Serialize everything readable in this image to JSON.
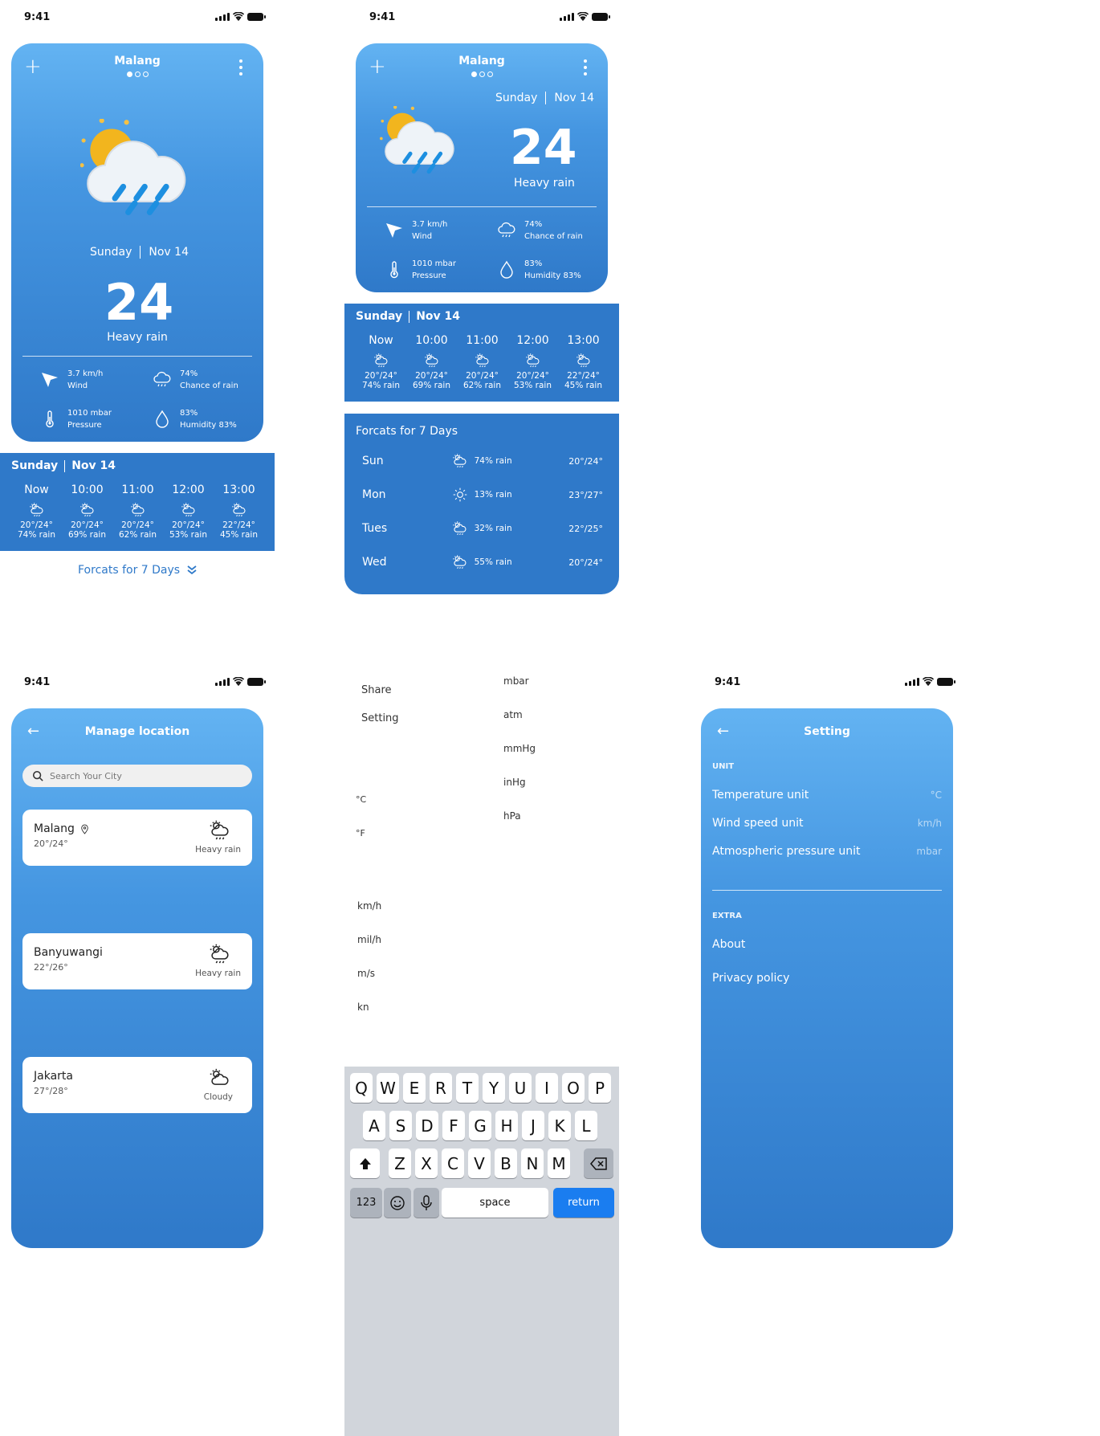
{
  "status": {
    "time": "9:41"
  },
  "screen1": {
    "city": "Malang",
    "day": "Sunday",
    "date": "Nov 14",
    "temp": "24",
    "deg_symbol": "°",
    "condition": "Heavy rain",
    "stats": {
      "wind_value": "3.7 km/h",
      "wind_label": "Wind",
      "rain_value": "74%",
      "rain_label": "Chance of rain",
      "pressure_value": "1010 mbar",
      "pressure_label": "Pressure",
      "humidity_value": "83%",
      "humidity_label": "Humidity 83%"
    },
    "hourly": {
      "day": "Sunday",
      "date": "Nov 14",
      "items": [
        {
          "time": "Now",
          "temps": "20°/24°",
          "rain": "74% rain"
        },
        {
          "time": "10:00",
          "temps": "20°/24°",
          "rain": "69% rain"
        },
        {
          "time": "11:00",
          "temps": "20°/24°",
          "rain": "62% rain"
        },
        {
          "time": "12:00",
          "temps": "20°/24°",
          "rain": "53% rain"
        },
        {
          "time": "13:00",
          "temps": "22°/24°",
          "rain": "45% rain"
        }
      ]
    },
    "forecast_link": "Forcats for 7 Days"
  },
  "screen2": {
    "city": "Malang",
    "day": "Sunday",
    "date": "Nov 14",
    "temp": "24",
    "deg_symbol": "°",
    "condition": "Heavy rain",
    "stats": {
      "wind_value": "3.7 km/h",
      "wind_label": "Wind",
      "rain_value": "74%",
      "rain_label": "Chance of rain",
      "pressure_value": "1010 mbar",
      "pressure_label": "Pressure",
      "humidity_value": "83%",
      "humidity_label": "Humidity 83%"
    },
    "hourly": {
      "day": "Sunday",
      "date": "Nov 14",
      "items": [
        {
          "time": "Now",
          "temps": "20°/24°",
          "rain": "74% rain"
        },
        {
          "time": "10:00",
          "temps": "20°/24°",
          "rain": "69% rain"
        },
        {
          "time": "11:00",
          "temps": "20°/24°",
          "rain": "62% rain"
        },
        {
          "time": "12:00",
          "temps": "20°/24°",
          "rain": "53% rain"
        },
        {
          "time": "13:00",
          "temps": "22°/24°",
          "rain": "45% rain"
        }
      ]
    },
    "forecast": {
      "title": "Forcats for 7 Days",
      "rows": [
        {
          "day": "Sun",
          "icon": "cloud-sun-rain-icon",
          "rain": "74% rain",
          "temps": "20°/24°"
        },
        {
          "day": "Mon",
          "icon": "sun-icon",
          "rain": "13% rain",
          "temps": "23°/27°"
        },
        {
          "day": "Tues",
          "icon": "cloud-sun-rain-icon",
          "rain": "32% rain",
          "temps": "22°/25°"
        },
        {
          "day": "Wed",
          "icon": "cloud-sun-rain-icon",
          "rain": "55% rain",
          "temps": "20°/24°"
        }
      ]
    }
  },
  "screen3": {
    "title": "Manage location",
    "search_placeholder": "Search Your City",
    "locations": [
      {
        "name": "Malang",
        "temps": "20°/24°",
        "condition": "Heavy rain",
        "pinned": true
      },
      {
        "name": "Banyuwangi",
        "temps": "22°/26°",
        "condition": "Heavy rain",
        "pinned": false
      },
      {
        "name": "Jakarta",
        "temps": "27°/28°",
        "condition": "Cloudy",
        "pinned": false
      }
    ]
  },
  "menus": {
    "overflow": [
      "Share",
      "Setting"
    ],
    "pressure_units": [
      "mbar",
      "atm",
      "mmHg",
      "inHg",
      "hPa"
    ],
    "temp_units": [
      "°C",
      "°F"
    ],
    "wind_units": [
      "km/h",
      "mil/h",
      "m/s",
      "kn"
    ]
  },
  "keyboard": {
    "row1": [
      "Q",
      "W",
      "E",
      "R",
      "T",
      "Y",
      "U",
      "I",
      "O",
      "P"
    ],
    "row2": [
      "A",
      "S",
      "D",
      "F",
      "G",
      "H",
      "J",
      "K",
      "L"
    ],
    "row3": [
      "Z",
      "X",
      "C",
      "V",
      "B",
      "N",
      "M"
    ],
    "numbers": "123",
    "space": "space",
    "return": "return"
  },
  "screen5": {
    "title": "Setting",
    "unit_label": "UNIT",
    "rows": [
      {
        "label": "Temperature unit",
        "value": "°C"
      },
      {
        "label": "Wind speed unit",
        "value": "km/h"
      },
      {
        "label": "Atmospheric pressure unit",
        "value": "mbar"
      }
    ],
    "extra_label": "EXTRA",
    "extra": [
      "About",
      "Privacy policy"
    ]
  },
  "colors": {
    "primary": "#2f79c9",
    "light": "#63b3f2",
    "accent": "#1a7df0"
  }
}
